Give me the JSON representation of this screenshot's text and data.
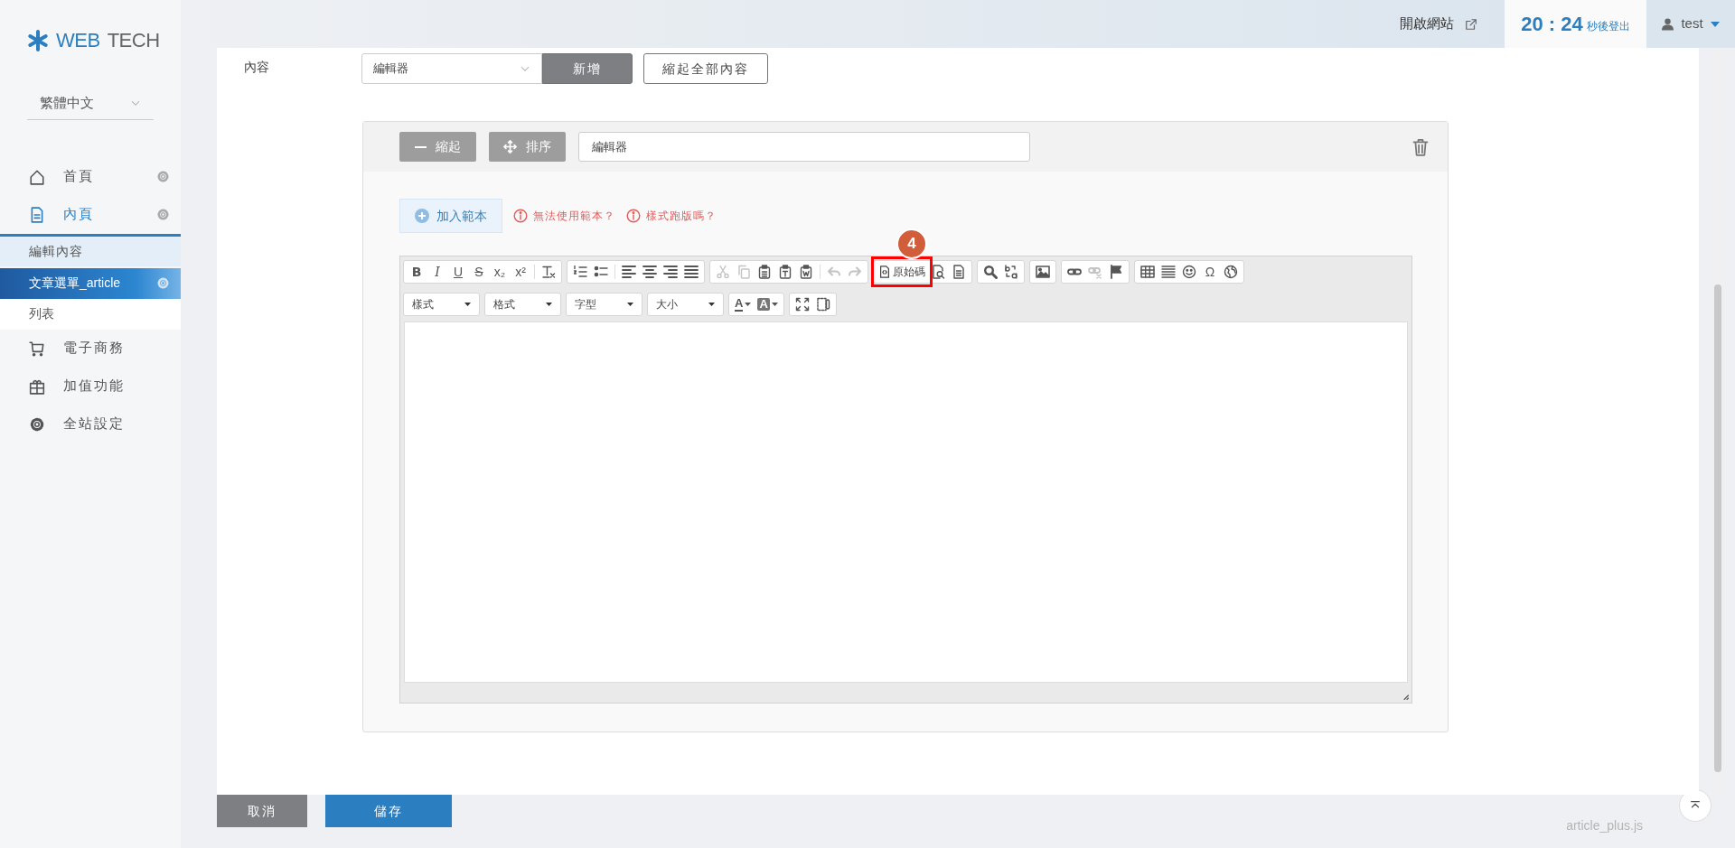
{
  "sidebar": {
    "logo": {
      "primary": "WEB",
      "secondary": "TECH"
    },
    "language": {
      "value": "繁體中文"
    },
    "items": [
      {
        "label": "首頁",
        "selected": false,
        "expanded": false,
        "settings": true
      },
      {
        "label": "內頁",
        "selected": false,
        "expanded": true,
        "settings": true,
        "children": [
          {
            "label": "編輯內容",
            "kind": "heading",
            "selected": false,
            "settings": false
          },
          {
            "label": "文章選單_article",
            "kind": "link",
            "selected": true,
            "settings": true
          },
          {
            "label": "列表",
            "kind": "link",
            "selected": false,
            "settings": false
          }
        ]
      },
      {
        "label": "電子商務",
        "selected": false,
        "expanded": false,
        "settings": false
      },
      {
        "label": "加值功能",
        "selected": false,
        "expanded": false,
        "settings": false
      },
      {
        "label": "全站設定",
        "selected": false,
        "expanded": false,
        "settings": false
      }
    ]
  },
  "topbar": {
    "open_site": "開啟網站",
    "countdown": "20 : 24",
    "countdown_suffix": "秒後登出",
    "user": "test"
  },
  "form": {
    "label": "內容",
    "block_type": {
      "value": "編輯器"
    },
    "add_button": "新增",
    "collapse_all_button": "縮起全部內容",
    "block": {
      "collapse_button": "縮起",
      "sort_button": "排序",
      "title_input": {
        "value": "編輯器"
      },
      "add_template_button": "加入範本",
      "warnings": [
        "無法使用範本？",
        "樣式跑版嗎？"
      ],
      "toolbar_rows": [
        [
          [
            {
              "kind": "glyph",
              "label": "B",
              "disabled": false
            },
            {
              "kind": "glyph",
              "label": "I",
              "disabled": false
            },
            {
              "kind": "glyph",
              "label": "U",
              "disabled": false
            },
            {
              "kind": "glyph",
              "label": "S",
              "disabled": false
            },
            {
              "kind": "glyph",
              "label": "x₂",
              "disabled": false
            },
            {
              "kind": "glyph",
              "label": "x²",
              "disabled": false
            },
            {
              "kind": "separator"
            },
            {
              "kind": "icon",
              "disabled": false
            }
          ],
          [
            {
              "kind": "icon",
              "disabled": false
            },
            {
              "kind": "icon",
              "disabled": false
            },
            {
              "kind": "separator"
            },
            {
              "kind": "icon",
              "disabled": false
            },
            {
              "kind": "icon",
              "disabled": false
            },
            {
              "kind": "icon",
              "disabled": false
            },
            {
              "kind": "icon",
              "disabled": false
            }
          ],
          [
            {
              "kind": "icon",
              "disabled": true
            },
            {
              "kind": "icon",
              "disabled": true
            },
            {
              "kind": "icon",
              "disabled": false
            },
            {
              "kind": "icon",
              "disabled": false
            },
            {
              "kind": "icon",
              "disabled": false
            },
            {
              "kind": "separator"
            },
            {
              "kind": "icon",
              "disabled": true
            },
            {
              "kind": "icon",
              "disabled": true
            }
          ],
          [
            {
              "kind": "source",
              "label": "原始碼",
              "disabled": false
            },
            {
              "kind": "icon",
              "disabled": false
            },
            {
              "kind": "icon",
              "disabled": false
            }
          ],
          [
            {
              "kind": "icon",
              "disabled": false
            },
            {
              "kind": "icon",
              "disabled": false
            }
          ],
          [
            {
              "kind": "icon",
              "disabled": false
            }
          ],
          [
            {
              "kind": "icon",
              "disabled": false
            },
            {
              "kind": "icon",
              "disabled": true
            },
            {
              "kind": "icon",
              "disabled": false
            }
          ],
          [
            {
              "kind": "icon",
              "disabled": false
            },
            {
              "kind": "icon",
              "disabled": false
            },
            {
              "kind": "icon",
              "disabled": false
            },
            {
              "kind": "glyph",
              "label": "Ω",
              "disabled": false
            },
            {
              "kind": "icon",
              "disabled": false
            }
          ]
        ],
        [
          [
            {
              "kind": "combo",
              "label": "樣式"
            }
          ],
          [
            {
              "kind": "combo",
              "label": "格式"
            }
          ],
          [
            {
              "kind": "combo",
              "label": "字型"
            }
          ],
          [
            {
              "kind": "combo",
              "label": "大小"
            }
          ],
          [
            {
              "kind": "color",
              "label": "A",
              "disabled": false
            },
            {
              "kind": "bgcolor",
              "label": "A",
              "disabled": false
            }
          ],
          [
            {
              "kind": "icon",
              "disabled": false
            },
            {
              "kind": "icon",
              "disabled": false
            }
          ]
        ]
      ]
    }
  },
  "callout": {
    "number": "4"
  },
  "footer": {
    "cancel": "取消",
    "save": "儲存",
    "script_name": "article_plus.js"
  }
}
